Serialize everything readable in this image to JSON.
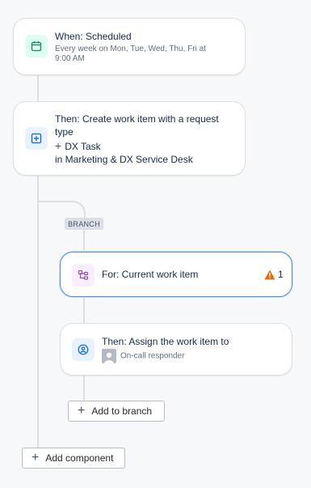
{
  "trigger": {
    "icon": "calendar-icon",
    "title": "When: Scheduled",
    "subtitle_line1": "Every week on Mon, Tue, Wed, Thu, Fri at",
    "subtitle_line2": "9:00 AM"
  },
  "create_action": {
    "icon": "add-square-icon",
    "title_line1": "Then: Create work item with a request",
    "title_line2": "type",
    "request_type": "DX Task",
    "location": "in Marketing & DX Service Desk"
  },
  "branch": {
    "badge": "BRANCH",
    "branch_card": {
      "icon": "branch-icon",
      "title": "For: Current work item",
      "warning_count": "1"
    },
    "assign_action": {
      "icon": "assign-user-icon",
      "title": "Then: Assign the work item to",
      "assignee": "On-call responder"
    },
    "add_to_branch_label": "Add to branch"
  },
  "add_component_label": "Add component",
  "colors": {
    "accent_border": "#4c8fdc",
    "trigger_icon_bg": "#dcfff1",
    "action_icon_bg": "#e9f2ff",
    "branch_icon_bg": "#f8eefe",
    "warning": "#e56910"
  }
}
